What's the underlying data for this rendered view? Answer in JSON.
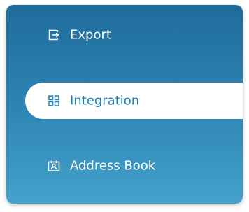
{
  "menu": {
    "items": [
      {
        "label": "Export",
        "icon": "export-icon"
      },
      {
        "label": "Integration",
        "icon": "grid-icon",
        "active": true
      },
      {
        "label": "Address Book",
        "icon": "address-book-icon"
      }
    ]
  },
  "colors": {
    "gradient_top": "#1f6c9c",
    "gradient_bottom": "#44a2cc",
    "active_background": "#ffffff",
    "active_text": "#2082b8",
    "text": "#ffffff"
  }
}
